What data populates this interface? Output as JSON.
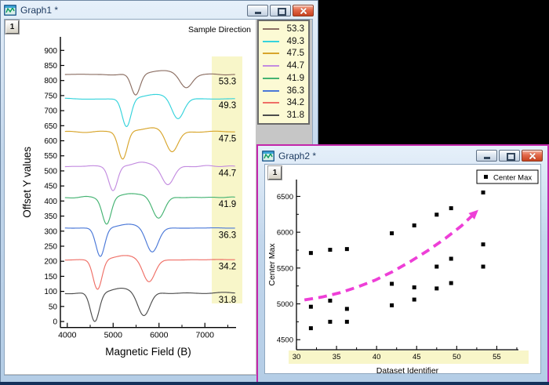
{
  "workspace": {
    "background": "#000000",
    "bottom_edge_color": "#14305a"
  },
  "graph1_window": {
    "title": "Graph1 *",
    "layer_badge": "1",
    "window_buttons": [
      "minimize",
      "restore",
      "close"
    ],
    "active": false
  },
  "graph2_window": {
    "title": "Graph2 *",
    "layer_badge": "1",
    "window_buttons": [
      "minimize",
      "restore",
      "close"
    ],
    "active": true,
    "accent_border": "#c327ab"
  },
  "chart_data": [
    {
      "type": "line",
      "title": "Sample Direction",
      "xlabel": "Magnetic Field (B)",
      "ylabel": "Offset Y values",
      "x_range": [
        3850,
        7680
      ],
      "y_range": [
        -20,
        945
      ],
      "x_ticks": [
        4000,
        5000,
        6000,
        7000
      ],
      "x_minor_ticks": [
        4500,
        5500,
        6500,
        7500
      ],
      "y_tick_min": 0,
      "y_tick_max": 900,
      "y_tick_step": 50,
      "grid": false,
      "label_band": {
        "color": "#f8f6c9",
        "x_from": 7150
      },
      "curve_x_start": 3950,
      "curve_x_end": 7660,
      "series": [
        {
          "label": "31.8",
          "color": "#4d4d4d",
          "baseline": 95,
          "dip1_center": 4600,
          "dip2_center": 5670,
          "dip1_depth": 95,
          "dip2_depth": 78
        },
        {
          "label": "34.2",
          "color": "#ef6f66",
          "baseline": 205,
          "dip1_center": 4660,
          "dip2_center": 5780,
          "dip1_depth": 98,
          "dip2_depth": 75
        },
        {
          "label": "36.3",
          "color": "#4a78d8",
          "baseline": 310,
          "dip1_center": 4720,
          "dip2_center": 5850,
          "dip1_depth": 95,
          "dip2_depth": 80
        },
        {
          "label": "41.9",
          "color": "#44b372",
          "baseline": 412,
          "dip1_center": 4860,
          "dip2_center": 5985,
          "dip1_depth": 88,
          "dip2_depth": 70
        },
        {
          "label": "44.7",
          "color": "#c38ce0",
          "baseline": 515,
          "dip1_center": 5000,
          "dip2_center": 6190,
          "dip1_depth": 82,
          "dip2_depth": 62
        },
        {
          "label": "47.5",
          "color": "#d8a52c",
          "baseline": 630,
          "dip1_center": 5210,
          "dip2_center": 6280,
          "dip1_depth": 92,
          "dip2_depth": 68
        },
        {
          "label": "49.3",
          "color": "#35d3dc",
          "baseline": 740,
          "dip1_center": 5293,
          "dip2_center": 6410,
          "dip1_depth": 93,
          "dip2_depth": 70
        },
        {
          "label": "53.3",
          "color": "#8c6f63",
          "baseline": 820,
          "dip1_center": 5490,
          "dip2_center": 6590,
          "dip1_depth": 68,
          "dip2_depth": 45
        }
      ],
      "legend_order_top_to_bottom": [
        "53.3",
        "49.3",
        "47.5",
        "44.7",
        "41.9",
        "36.3",
        "34.2",
        "31.8"
      ]
    },
    {
      "type": "scatter",
      "legend": {
        "label": "Center Max",
        "marker": "black-square"
      },
      "xlabel": "Dataset Identifier",
      "ylabel": "Center Max",
      "x_range": [
        30,
        57.7
      ],
      "y_range": [
        4360,
        6735
      ],
      "x_ticks": [
        30,
        35,
        40,
        45,
        50,
        55
      ],
      "x_minor_step": 2.5,
      "y_ticks": [
        4500,
        5000,
        5500,
        6000,
        6500
      ],
      "y_minor_step": 250,
      "grid": false,
      "axis_band_color": "#f8f6c9",
      "marker_color": "#000000",
      "points": [
        [
          31.8,
          5710
        ],
        [
          31.8,
          4960
        ],
        [
          31.8,
          4660
        ],
        [
          34.2,
          5755
        ],
        [
          34.2,
          5045
        ],
        [
          34.2,
          4750
        ],
        [
          36.3,
          5765
        ],
        [
          36.3,
          4930
        ],
        [
          36.3,
          4750
        ],
        [
          41.9,
          5985
        ],
        [
          41.9,
          5280
        ],
        [
          41.9,
          4980
        ],
        [
          44.7,
          6095
        ],
        [
          44.7,
          5230
        ],
        [
          44.7,
          5060
        ],
        [
          47.5,
          6245
        ],
        [
          47.5,
          5520
        ],
        [
          47.5,
          5215
        ],
        [
          49.3,
          6335
        ],
        [
          49.3,
          5630
        ],
        [
          49.3,
          5290
        ],
        [
          53.3,
          6555
        ],
        [
          53.3,
          5830
        ],
        [
          53.3,
          5520
        ]
      ],
      "trend_arrow": {
        "color": "#ee3fd7",
        "style": "dashed",
        "points": [
          [
            31.0,
            5055
          ],
          [
            33.2,
            5095
          ],
          [
            35.4,
            5155
          ],
          [
            37.6,
            5235
          ],
          [
            39.8,
            5330
          ],
          [
            42.0,
            5450
          ],
          [
            44.2,
            5590
          ],
          [
            46.4,
            5745
          ],
          [
            48.6,
            5915
          ],
          [
            50.6,
            6090
          ],
          [
            52.2,
            6260
          ]
        ]
      }
    }
  ]
}
